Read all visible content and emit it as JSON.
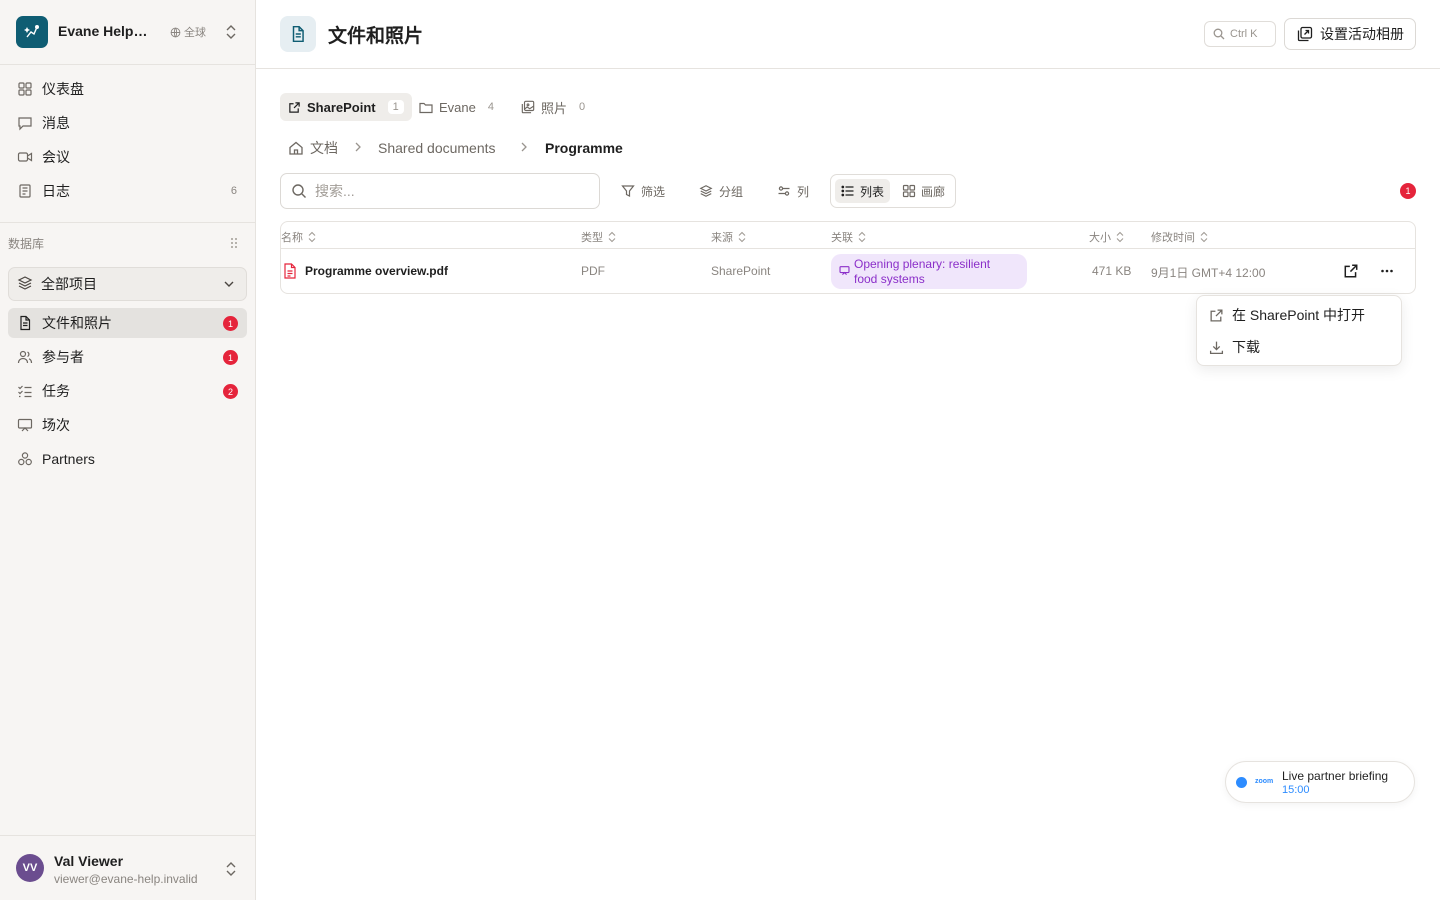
{
  "workspace": {
    "name": "Evane Help Desk",
    "scope": "全球"
  },
  "nav": [
    {
      "label": "仪表盘",
      "icon": "dashboard-icon"
    },
    {
      "label": "消息",
      "icon": "message-icon"
    },
    {
      "label": "会议",
      "icon": "video-icon"
    },
    {
      "label": "日志",
      "icon": "log-icon",
      "count": "6"
    }
  ],
  "database": {
    "title": "数据库",
    "all_items": "全部项目",
    "items": [
      {
        "label": "文件和照片",
        "icon": "file-icon",
        "badge": "1",
        "active": true
      },
      {
        "label": "参与者",
        "icon": "users-icon",
        "badge": "1"
      },
      {
        "label": "任务",
        "icon": "tasks-icon",
        "badge": "2"
      },
      {
        "label": "场次",
        "icon": "session-icon"
      },
      {
        "label": "Partners",
        "icon": "partners-icon"
      }
    ]
  },
  "user": {
    "initials": "VV",
    "name": "Val Viewer",
    "email": "viewer@evane-help.invalid"
  },
  "header": {
    "title": "文件和照片",
    "shortcut": "Ctrl K",
    "setup_button": "设置活动相册"
  },
  "source_tabs": [
    {
      "label": "SharePoint",
      "count": "1",
      "icon": "external-link-icon",
      "active": true
    },
    {
      "label": "Evane",
      "count": "4",
      "icon": "folder-icon"
    },
    {
      "label": "照片",
      "count": "0",
      "icon": "gallery-icon"
    }
  ],
  "breadcrumb": [
    "文档",
    "Shared documents",
    "Programme"
  ],
  "toolbar": {
    "search_placeholder": "搜索...",
    "filter": "筛选",
    "group": "分组",
    "columns": "列",
    "view_list": "列表",
    "view_gallery": "画廊",
    "notification_count": "1"
  },
  "table": {
    "columns": [
      "名称",
      "类型",
      "来源",
      "关联",
      "大小",
      "修改时间"
    ],
    "rows": [
      {
        "name": "Programme overview.pdf",
        "type": "PDF",
        "source": "SharePoint",
        "link_line1": "Opening plenary: resilient",
        "link_line2": "food systems",
        "size": "471 KB",
        "modified": "9月1日 GMT+4 12:00"
      }
    ]
  },
  "row_menu": {
    "open_in": "在 SharePoint 中打开",
    "download": "下载"
  },
  "meeting_pill": {
    "app": "zoom",
    "title": "Live partner briefing",
    "time": "15:00"
  },
  "colors": {
    "accent": "#0f5d73",
    "badge": "#e5243b",
    "link_chip_text": "#8b2fc9",
    "link_chip_bg": "#f0e6fb",
    "zoom": "#2d8cff"
  }
}
